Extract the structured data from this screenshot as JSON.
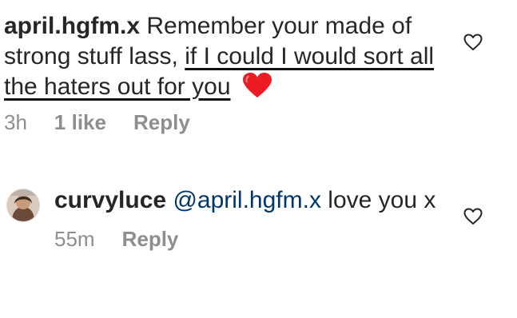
{
  "comments": [
    {
      "username": "april.hgfm.x",
      "text_before": "Remember your made of strong stuff lass,",
      "text_underlined": "if I could I would sort all the haters out for you",
      "emoji": "red-heart",
      "time": "3h",
      "likes": "1 like",
      "reply": "Reply"
    },
    {
      "username": "curvyluce",
      "mention": "@april.hgfm.x",
      "text": "love you x",
      "time": "55m",
      "reply": "Reply"
    }
  ],
  "icons": {
    "like": "heart-outline-icon",
    "emoji": "red-heart-emoji"
  },
  "colors": {
    "text": "#262626",
    "muted": "#8e8e8e",
    "mention": "#00376b",
    "heart": "#ed1c24"
  }
}
